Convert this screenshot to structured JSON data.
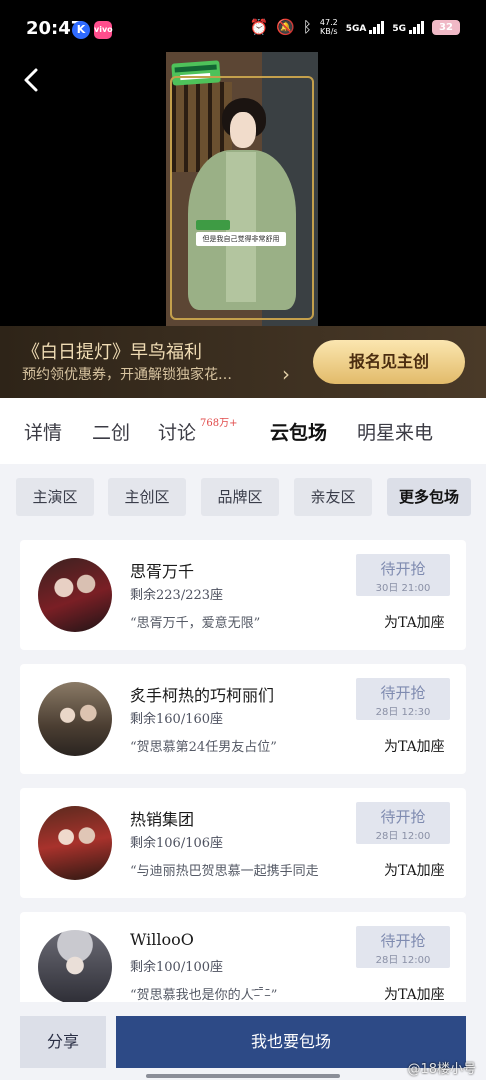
{
  "status_bar": {
    "time": "20:47",
    "app1": "K",
    "app2": "vivo",
    "speed_value": "47.2",
    "speed_unit": "KB/s",
    "net1": "5GA",
    "net2": "5G",
    "battery": "32",
    "icons": [
      "alarm-icon",
      "mute-icon",
      "bluetooth-icon"
    ]
  },
  "video": {
    "subtitle": "但是我自己觉得非常舒用"
  },
  "promo": {
    "title": "《白日提灯》早鸟福利",
    "subtitle": "预约领优惠券，开通解锁独家花…",
    "button": "报名见主创"
  },
  "tabs": {
    "items": [
      "详情",
      "二创",
      "讨论",
      "云包场",
      "明星来电"
    ],
    "discussion_count": "768万+",
    "active": "云包场"
  },
  "zones": [
    "主演区",
    "主创区",
    "品牌区",
    "亲友区",
    "更多包场"
  ],
  "cards": [
    {
      "name": "思胥万千",
      "seats": "剩余223/223座",
      "quote": "“思胥万千，爱意无限”",
      "status": "待开抢",
      "date": "30日 21:00",
      "action": "为TA加座"
    },
    {
      "name": "炙手柯热的巧柯丽们",
      "seats": "剩余160/160座",
      "quote": "“贺思慕第24任男友占位”",
      "status": "待开抢",
      "date": "28日 12:30",
      "action": "为TA加座"
    },
    {
      "name": "热销集团",
      "seats": "剩余106/106座",
      "quote": "“与迪丽热巴贺思慕一起携手同走",
      "status": "待开抢",
      "date": "28日 12:00",
      "action": "为TA加座"
    },
    {
      "name": "WillooO",
      "seats": "剩余100/100座",
      "quote": "“贺思慕我也是你的人̄–̄ ̄̄–̄”",
      "status": "待开抢",
      "date": "28日 12:00",
      "action": "为TA加座"
    }
  ],
  "bottom": {
    "share": "分享",
    "main": "我也要包场",
    "watermark": "@18楼小号"
  },
  "colors": {
    "primary": "#2d4a86",
    "promo_gold": "#e2bb6a",
    "badge_red": "#e14b4b"
  }
}
